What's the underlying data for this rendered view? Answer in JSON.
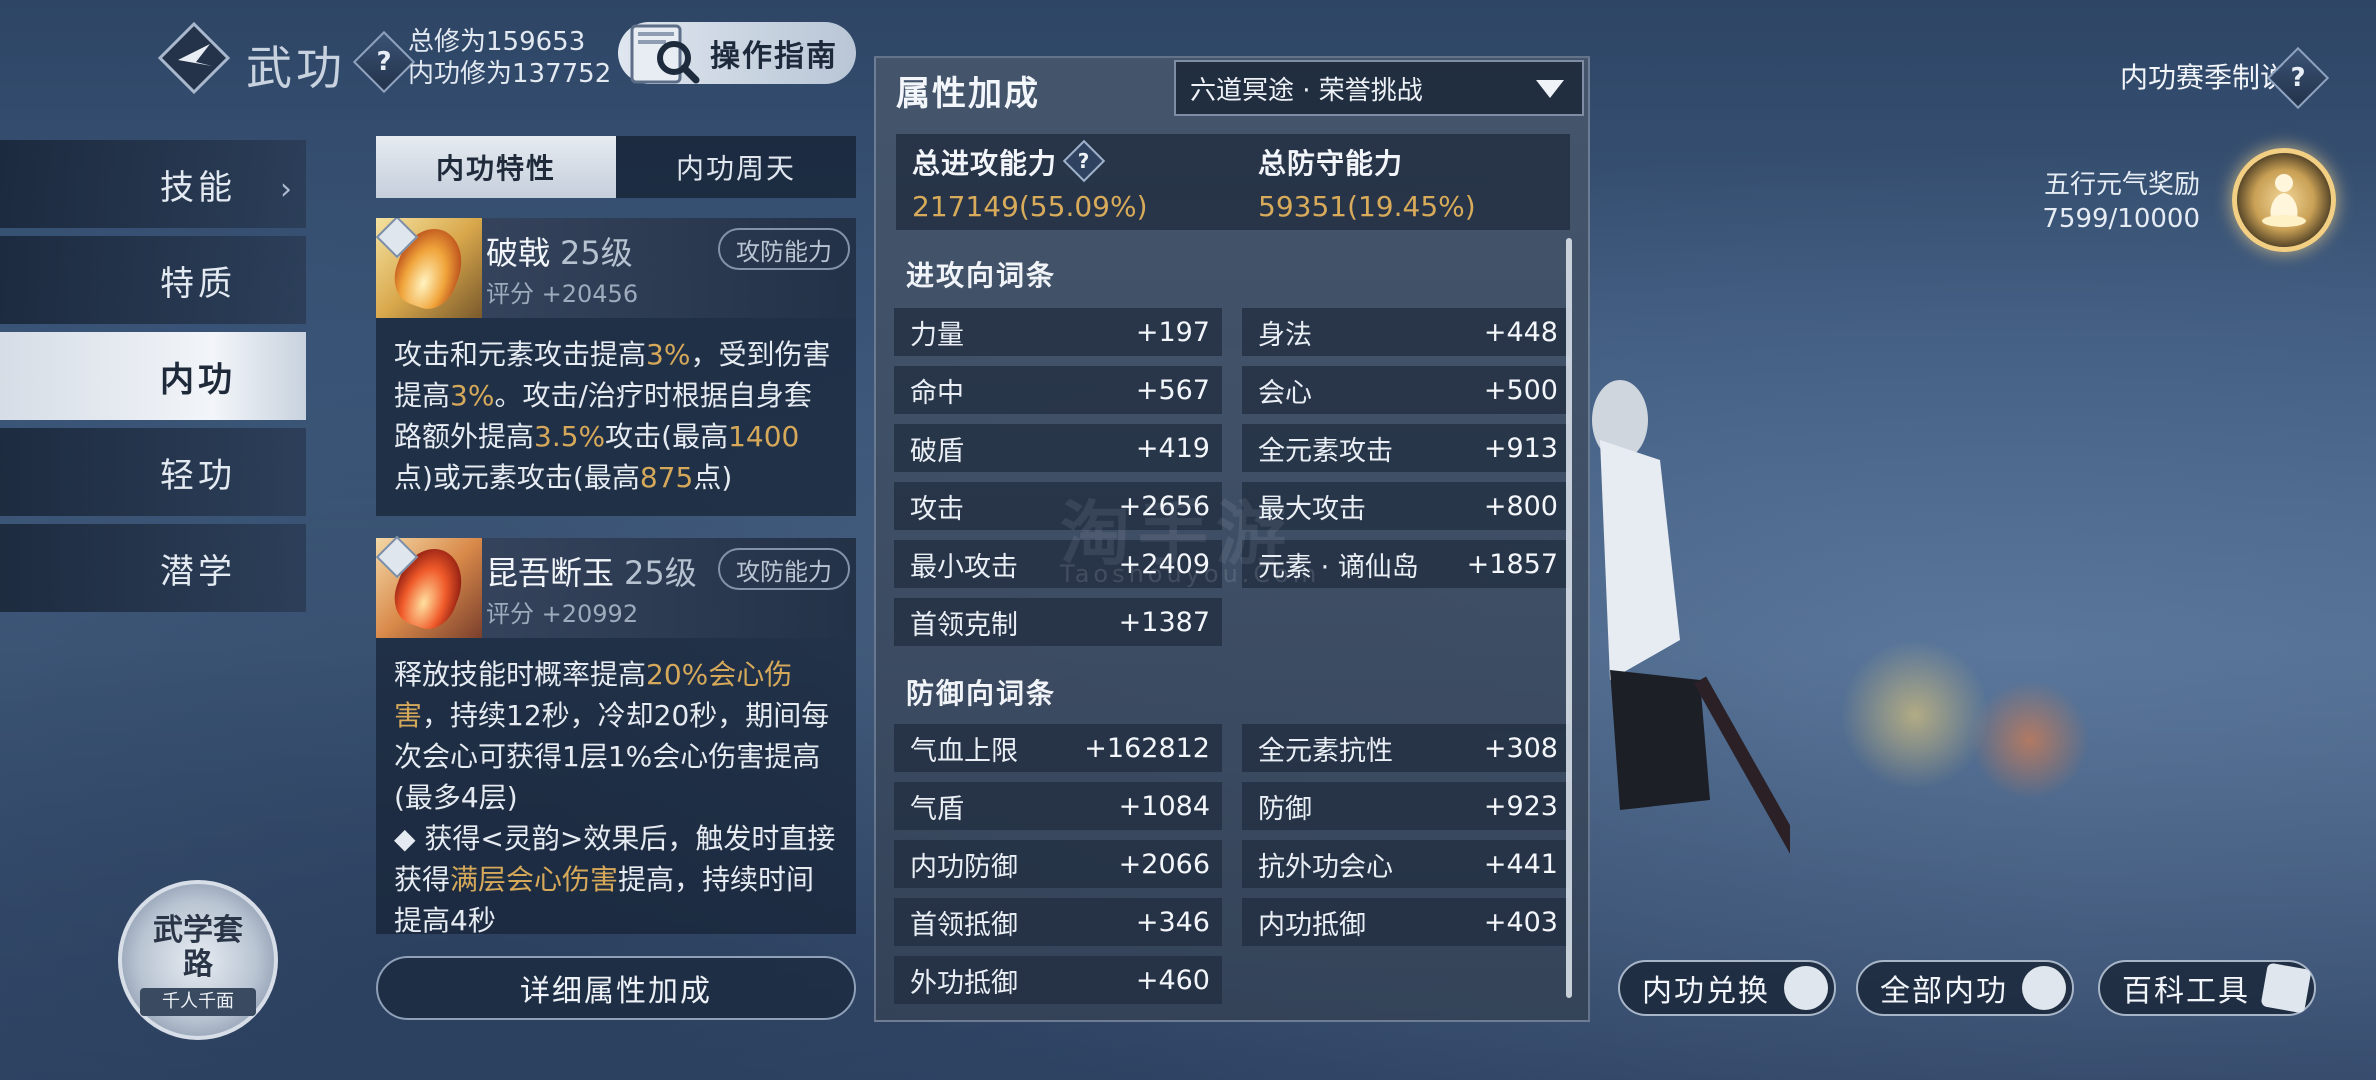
{
  "header": {
    "title": "武功",
    "total_cultivation": "总修为159653",
    "inner_cultivation": "内功修为137752",
    "guide_button": "操作指南",
    "help_icon": "question-diamond-icon"
  },
  "top_right": {
    "season_rules": "内功赛季制说明",
    "reward_label": "五行元气奖励",
    "reward_progress": "7599/10000",
    "reward_progress_value": 0.7599
  },
  "nav": {
    "items": [
      {
        "label": "技能"
      },
      {
        "label": "特质"
      },
      {
        "label": "内功"
      },
      {
        "label": "轻功"
      },
      {
        "label": "潜学"
      }
    ],
    "active_index": 2
  },
  "style_badge": {
    "title": "武学套路",
    "subtitle": "千人千面"
  },
  "skill_panel": {
    "tabs": [
      "内功特性",
      "内功周天"
    ],
    "active_tab": 0,
    "skills": [
      {
        "name": "破戟",
        "level": "25级",
        "score": "评分 +20456",
        "tag": "攻防能力",
        "desc_parts": [
          "攻击和元素攻击提高",
          "3%",
          "，受到伤害提高",
          "3%",
          "。攻击/治疗时根据自身套路额外提高",
          "3.5%",
          "攻击(最高",
          "1400",
          "点)或元素攻击(最高",
          "875",
          "点)"
        ]
      },
      {
        "name": "昆吾断玉",
        "level": "25级",
        "score": "评分 +20992",
        "tag": "攻防能力",
        "desc_parts": [
          "释放技能时概率提高",
          "20%会心伤害",
          "，持续12秒，冷却20秒，期间每次会心可获得1层1%会心伤害提高(最多4层)",
          "◆ 获得<灵韵>效果后，触发时直接获得",
          "满层会心伤害",
          "提高，持续时间提高4秒"
        ]
      }
    ],
    "detail_button": "详细属性加成"
  },
  "attr_panel": {
    "title": "属性加成",
    "mode_select": "六道冥途 · 荣誉挑战",
    "total_attack_label": "总进攻能力",
    "total_attack_value": "217149(55.09%)",
    "total_defense_label": "总防守能力",
    "total_defense_value": "59351(19.45%)",
    "attack_section": "进攻向词条",
    "attack_stats": [
      {
        "name": "力量",
        "value": "+197"
      },
      {
        "name": "身法",
        "value": "+448"
      },
      {
        "name": "命中",
        "value": "+567"
      },
      {
        "name": "会心",
        "value": "+500"
      },
      {
        "name": "破盾",
        "value": "+419"
      },
      {
        "name": "全元素攻击",
        "value": "+913"
      },
      {
        "name": "攻击",
        "value": "+2656"
      },
      {
        "name": "最大攻击",
        "value": "+800"
      },
      {
        "name": "最小攻击",
        "value": "+2409"
      },
      {
        "name": "元素 · 谪仙岛",
        "value": "+1857"
      },
      {
        "name": "首领克制",
        "value": "+1387"
      }
    ],
    "defense_section": "防御向词条",
    "defense_stats": [
      {
        "name": "气血上限",
        "value": "+162812"
      },
      {
        "name": "全元素抗性",
        "value": "+308"
      },
      {
        "name": "气盾",
        "value": "+1084"
      },
      {
        "name": "防御",
        "value": "+923"
      },
      {
        "name": "内功防御",
        "value": "+2066"
      },
      {
        "name": "抗外功会心",
        "value": "+441"
      },
      {
        "name": "首领抵御",
        "value": "+346"
      },
      {
        "name": "内功抵御",
        "value": "+403"
      },
      {
        "name": "外功抵御",
        "value": "+460"
      }
    ]
  },
  "watermark": {
    "text": "淘手游",
    "sub": "Taoshouyou.Com"
  },
  "bottom_buttons": [
    {
      "label": "内功兑换",
      "icon": "exchange-icon"
    },
    {
      "label": "全部内功",
      "icon": "cycle-icon"
    },
    {
      "label": "百科工具",
      "icon": "book-icon"
    }
  ],
  "colors": {
    "accent_gold": "#d8ab5a",
    "panel_bg": "#3e4e66"
  }
}
